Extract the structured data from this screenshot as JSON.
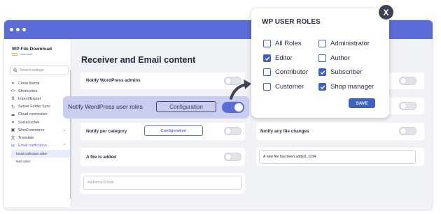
{
  "sidebar": {
    "plugin_title": "WP File Download",
    "brand": "JoomUnited",
    "search_placeholder": "Search settings",
    "items": [
      {
        "label": "Clone theme",
        "icon": "share-icon"
      },
      {
        "label": "Shortcodes",
        "icon": "code-icon"
      },
      {
        "label": "Import/Export",
        "icon": "import-export-icon"
      },
      {
        "label": "Server Folder Sync",
        "icon": "sync-icon"
      },
      {
        "label": "Cloud connection",
        "icon": "cloud-icon"
      },
      {
        "label": "Social locker",
        "icon": "social-icon"
      },
      {
        "label": "WooCommerce",
        "icon": "woocommerce-icon"
      },
      {
        "label": "Translate",
        "icon": "translate-icon"
      },
      {
        "label": "Email notification",
        "icon": "email-icon"
      }
    ],
    "subitems": [
      "Email notification editor",
      "Mail option"
    ]
  },
  "main": {
    "title": "Receiver and Email content",
    "rows": {
      "notify_admins": "Notify WordPress admins",
      "notify_roles": "Notify WordPress user roles",
      "configuration_label": "Configuration",
      "notify_category": "Notify per category",
      "notify_changes": "Notify any file changes",
      "file_added": "A file is added",
      "file_added_value": "A new file has been added_1234",
      "additional_email_placeholder": "Additional Email"
    }
  },
  "popup": {
    "title": "WP USER ROLES",
    "roles": [
      {
        "label": "All Roles",
        "checked": false
      },
      {
        "label": "Administrator",
        "checked": false
      },
      {
        "label": "Editor",
        "checked": true
      },
      {
        "label": "Author",
        "checked": false
      },
      {
        "label": "Contributor",
        "checked": false
      },
      {
        "label": "Subscriber",
        "checked": true
      },
      {
        "label": "Customer",
        "checked": false
      },
      {
        "label": "Shop manager",
        "checked": true
      }
    ],
    "save_label": "SAVE",
    "close_label": "X"
  },
  "colors": {
    "accent": "#5b6bd7",
    "checkbox": "#3d62c2",
    "highlight": "#c9cdf2"
  }
}
